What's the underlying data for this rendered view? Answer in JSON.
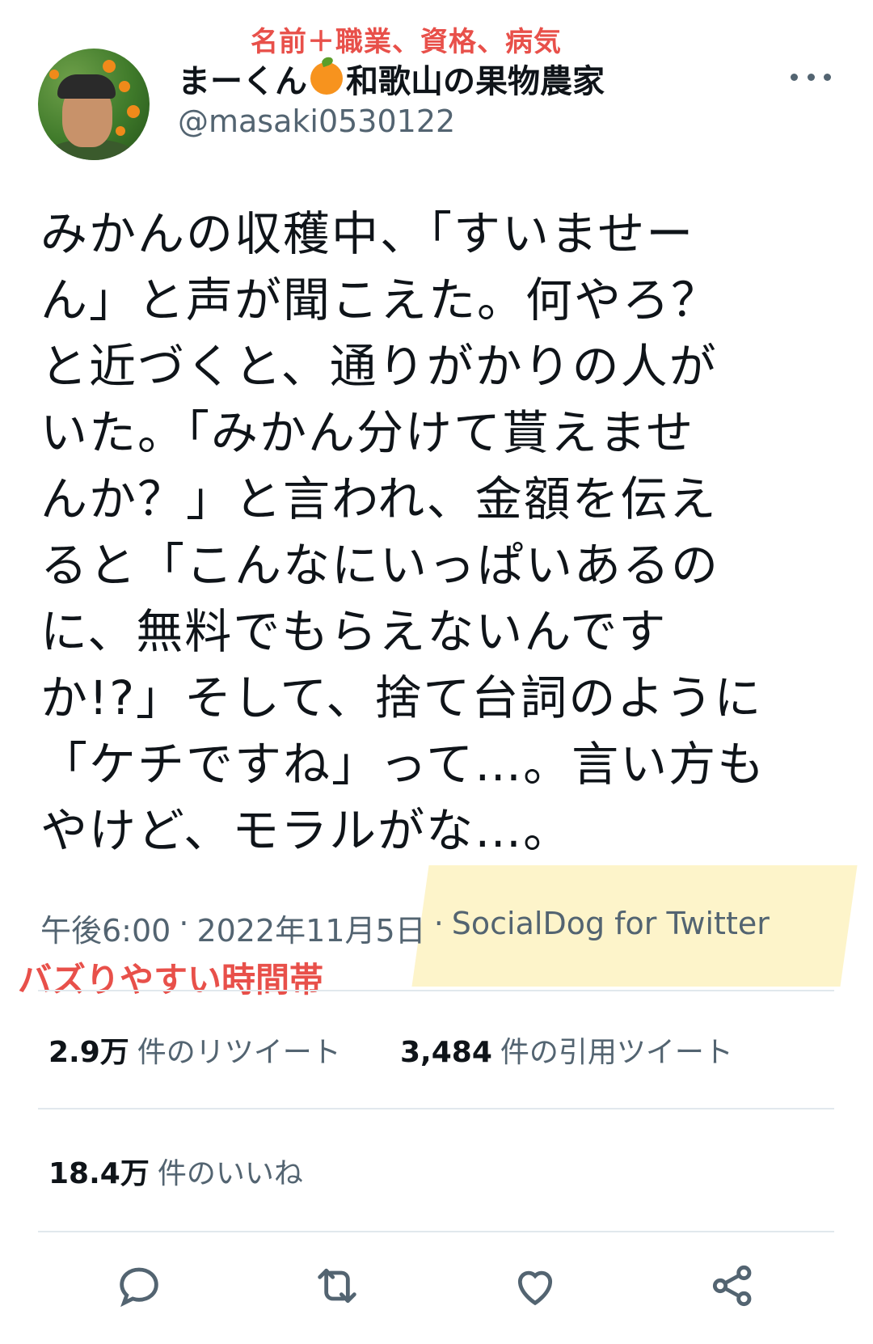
{
  "annotations": {
    "top": "名前＋職業、資格、病気",
    "bottom": "バズりやすい時間帯"
  },
  "user": {
    "display_name_pre": "まーくん",
    "display_name_post": "和歌山の果物農家",
    "handle": "@masaki0530122"
  },
  "tweet": {
    "text": "みかんの収穫中、「すいませー\nん」と声が聞こえた。何やろ？\nと近づくと、通りがかりの人が\nいた。「みかん分けて貰えませ\nんか？」と言われ、金額を伝え\nると「こんなにいっぱいあるの\nに、無料でもらえないんです\nか!?」そして、捨て台詞のように\n「ケチですね」って…。言い方も\nやけど、モラルがな…。",
    "time": "午後6:00",
    "date": "2022年11月5日",
    "separator": "·",
    "source": "SocialDog for Twitter"
  },
  "stats": {
    "retweets_count": "2.9万",
    "retweets_label": "件のリツイート",
    "quotes_count": "3,484",
    "quotes_label": "件の引用ツイート",
    "likes_count": "18.4万",
    "likes_label": "件のいいね"
  },
  "icons": {
    "reply": "reply-icon",
    "retweet": "retweet-icon",
    "like": "heart-icon",
    "share": "share-icon"
  },
  "colors": {
    "annotation": "#e8504a",
    "highlight": "#fdf3c4",
    "muted": "#536471"
  }
}
